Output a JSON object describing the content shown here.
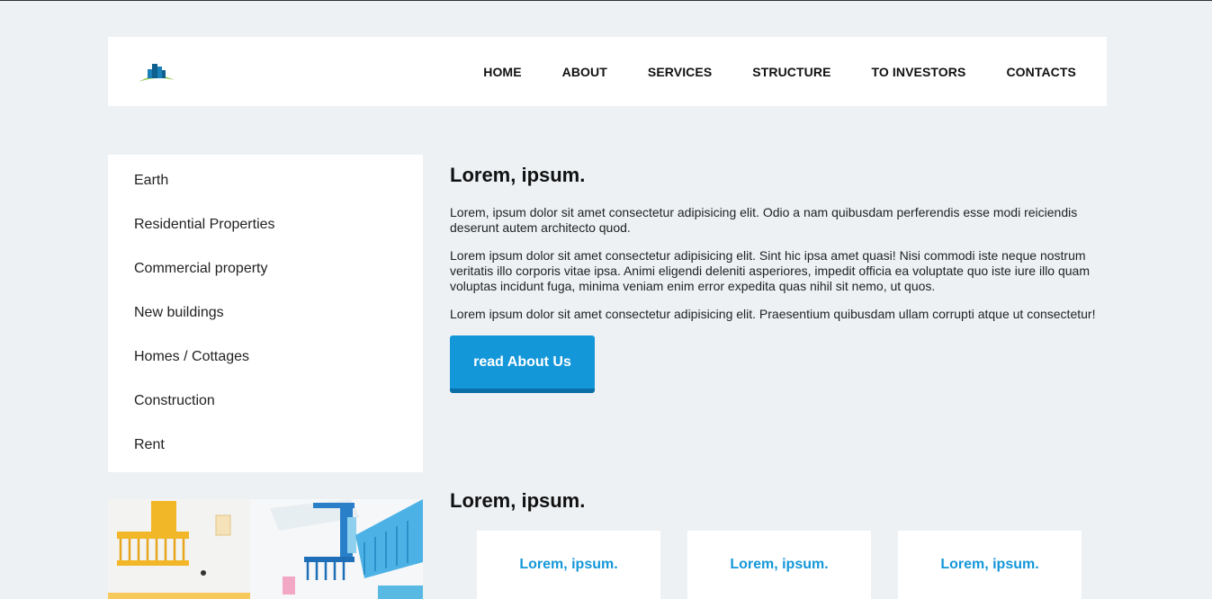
{
  "nav": {
    "items": [
      "HOME",
      "ABOUT",
      "SERVICES",
      "STRUCTURE",
      "TO INVESTORS",
      "CONTACTS"
    ]
  },
  "sidebar": {
    "items": [
      "Earth",
      "Residential Properties",
      "Commercial property",
      "New buildings",
      "Homes / Cottages",
      "Construction",
      "Rent"
    ]
  },
  "about": {
    "title": "Lorem, ipsum.",
    "paragraphs": [
      "Lorem, ipsum dolor sit amet consectetur adipisicing elit. Odio a nam quibusdam perferendis esse modi reiciendis deserunt autem architecto quod.",
      "Lorem ipsum dolor sit amet consectetur adipisicing elit. Sint hic ipsa amet quasi! Nisi commodi iste neque nostrum veritatis illo corporis vitae ipsa. Animi eligendi deleniti asperiores, impedit officia ea voluptate quo iste iure illo quam voluptas incidunt fuga, minima veniam enim error expedita quas nihil sit nemo, ut quos.",
      "Lorem ipsum dolor sit amet consectetur adipisicing elit. Praesentium quibusdam ullam corrupti atque ut consectetur!"
    ],
    "button_label": "read About Us"
  },
  "services": {
    "title": "Lorem, ipsum.",
    "cards": [
      "Lorem, ipsum.",
      "Lorem, ipsum.",
      "Lorem, ipsum."
    ]
  },
  "colors": {
    "accent": "#1497d9",
    "background": "#edf1f4"
  }
}
